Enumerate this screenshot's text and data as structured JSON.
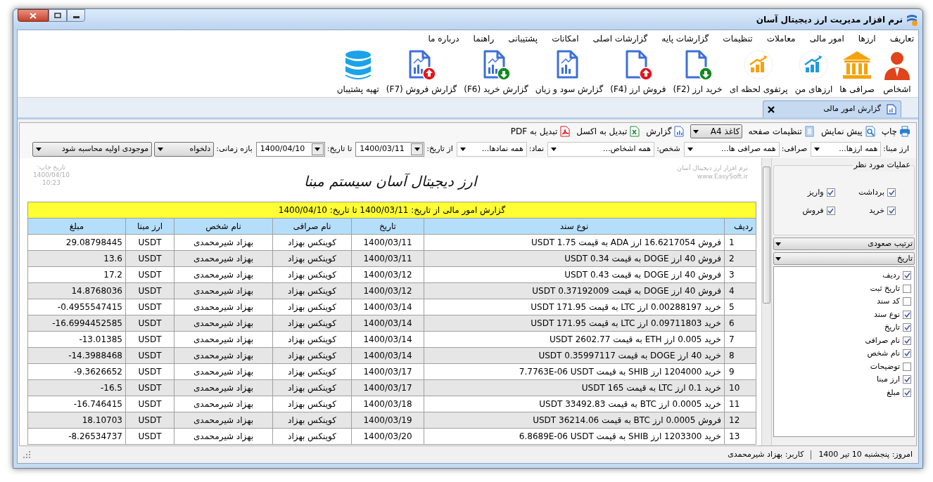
{
  "window": {
    "title": "نرم افزار مدیریت ارز دیجیتال آسان"
  },
  "menu": [
    "تعاریف",
    "ارزها",
    "امور مالی",
    "معاملات",
    "تنظیمات",
    "گزارشات پایه",
    "گزارشات اصلی",
    "امکانات",
    "پشتیبانی",
    "راهنما",
    "درباره ما"
  ],
  "toolbar": [
    {
      "label": "اشخاص"
    },
    {
      "label": "صرافی ها"
    },
    {
      "label": "ارزهای من"
    },
    {
      "label": "پرتفوی لحظه ای"
    },
    {
      "label": "خرید ارز (F2)"
    },
    {
      "label": "فروش ارز (F4)"
    },
    {
      "label": "گزارش سود و زیان"
    },
    {
      "label": "گزارش خرید (F6)"
    },
    {
      "label": "گزارش فروش (F7)"
    },
    {
      "label": "تهیه پشتیبان"
    }
  ],
  "tabs": [
    {
      "label": "گزارش امور مالی",
      "selected": true
    }
  ],
  "print_toolbar": [
    {
      "kind": "button",
      "label": "چاپ"
    },
    {
      "kind": "button",
      "label": "پیش نمایش"
    },
    {
      "kind": "button",
      "label": "تنظیمات صفحه"
    },
    {
      "kind": "dropdown",
      "value": "کاغذ A4"
    },
    {
      "kind": "button",
      "label": "گزارش"
    },
    {
      "kind": "button",
      "label": "تبدیل به اکسل"
    },
    {
      "kind": "button",
      "label": "تبدیل به PDF"
    }
  ],
  "filters": [
    {
      "kind": "combo",
      "label": "ارز مبنا:",
      "value": "همه ارزها..."
    },
    {
      "kind": "combo",
      "label": "صرافی:",
      "value": "همه صرافی ها..."
    },
    {
      "kind": "combo",
      "label": "شخص:",
      "value": "همه اشخاص..."
    },
    {
      "kind": "combo",
      "label": "نماد:",
      "value": "همه نمادها..."
    },
    {
      "kind": "date",
      "label": "از تاریخ:",
      "value": "1400/03/11"
    },
    {
      "kind": "date",
      "label": "تا تاریخ:",
      "value": "1400/04/10"
    },
    {
      "kind": "select",
      "label": "بازه زمانی:",
      "value": "دلخواه"
    },
    {
      "kind": "select",
      "value": "موجودی اولیه محاسبه شود"
    }
  ],
  "report": {
    "brand_lines": [
      "نرم افزار ارز دیجیتال آسان",
      "www.EasySoft.ir"
    ],
    "title": "ارز دیجیتال آسان سیستم مبنا",
    "print_info": [
      "تاریخ چاپ:",
      "1400/04/10",
      "10:23"
    ],
    "caption": "گزارش امور مالی از تاریخ: 1400/03/11 تا تاریخ: 1400/04/10",
    "table": {
      "columns": [
        "ردیف",
        "نوع سند",
        "تاریخ",
        "نام صرافی",
        "نام شخص",
        "ارز مبنا",
        "مبلغ"
      ],
      "rows": [
        [
          "1",
          "فروش 16.6217054 ارز ADA به قیمت 1.75 USDT",
          "1400/03/11",
          "کوینکس بهزاد",
          "بهزاد شیرمحمدی",
          "USDT",
          "29.08798445"
        ],
        [
          "2",
          "فروش 40 ارز DOGE به قیمت 0.34 USDT",
          "1400/03/11",
          "کوینکس بهزاد",
          "بهزاد شیرمحمدی",
          "USDT",
          "13.6"
        ],
        [
          "3",
          "فروش 40 ارز DOGE به قیمت 0.43 USDT",
          "1400/03/12",
          "کوینکس بهزاد",
          "بهزاد شیرمحمدی",
          "USDT",
          "17.2"
        ],
        [
          "4",
          "فروش 40 ارز DOGE به قیمت 0.37192009 USDT",
          "1400/03/12",
          "کوینکس بهزاد",
          "بهزاد شیرمحمدی",
          "USDT",
          "14.8768036"
        ],
        [
          "5",
          "خرید 0.00288197 ارز LTC به قیمت 171.95 USDT",
          "1400/03/14",
          "کوینکس بهزاد",
          "بهزاد شیرمحمدی",
          "USDT",
          "-0.4955547415"
        ],
        [
          "6",
          "خرید 0.09711803 ارز LTC به قیمت 171.95 USDT",
          "1400/03/14",
          "کوینکس بهزاد",
          "بهزاد شیرمحمدی",
          "USDT",
          "-16.6994452585"
        ],
        [
          "7",
          "خرید 0.005 ارز ETH به قیمت 2602.77 USDT",
          "1400/03/14",
          "کوینکس بهزاد",
          "بهزاد شیرمحمدی",
          "USDT",
          "-13.01385"
        ],
        [
          "8",
          "خرید 40 ارز DOGE به قیمت 0.35997117 USDT",
          "1400/03/14",
          "کوینکس بهزاد",
          "بهزاد شیرمحمدی",
          "USDT",
          "-14.3988468"
        ],
        [
          "9",
          "خرید 1204000 ارز SHIB به قیمت 7.7763E-06 USDT",
          "1400/03/17",
          "کوینکس بهزاد",
          "بهزاد شیرمحمدی",
          "USDT",
          "-9.3626652"
        ],
        [
          "10",
          "خرید 0.1 ارز LTC به قیمت 165 USDT",
          "1400/03/17",
          "کوینکس بهزاد",
          "بهزاد شیرمحمدی",
          "USDT",
          "-16.5"
        ],
        [
          "11",
          "خرید 0.0005 ارز BTC به قیمت 33492.83 USDT",
          "1400/03/18",
          "کوینکس بهزاد",
          "بهزاد شیرمحمدی",
          "USDT",
          "-16.746415"
        ],
        [
          "12",
          "فروش 0.0005 ارز BTC به قیمت 36214.06 USDT",
          "1400/03/19",
          "کوینکس بهزاد",
          "بهزاد شیرمحمدی",
          "USDT",
          "18.10703"
        ],
        [
          "13",
          "خرید 1203300 ارز SHIB به قیمت 6.8689E-06 USDT",
          "1400/03/20",
          "کوینکس بهزاد",
          "بهزاد شیرمحمدی",
          "USDT",
          "-8.26534737"
        ]
      ]
    }
  },
  "side_panel": {
    "group_title": "عملیات مورد نظر",
    "operations": [
      {
        "label": "برداشت",
        "checked": true
      },
      {
        "label": "واریز",
        "checked": true
      },
      {
        "label": "خرید",
        "checked": true
      },
      {
        "label": "فروش",
        "checked": true
      }
    ],
    "sort_order": "ترتیب صعودی",
    "sort_by": "تاریخ",
    "columns": [
      {
        "label": "ردیف",
        "checked": true
      },
      {
        "label": "تاریخ ثبت",
        "checked": false
      },
      {
        "label": "کد سند",
        "checked": false
      },
      {
        "label": "نوع سند",
        "checked": true
      },
      {
        "label": "تاریخ",
        "checked": true
      },
      {
        "label": "نام صرافی",
        "checked": true
      },
      {
        "label": "نام شخص",
        "checked": true
      },
      {
        "label": "توضیحات",
        "checked": false
      },
      {
        "label": "ارز مبنا",
        "checked": true
      },
      {
        "label": "مبلغ",
        "checked": true
      }
    ]
  },
  "status_bar": {
    "today": "امروز: پنجشنبه 10 تیر 1400",
    "user": "کاربر: بهزاد شیرمحمدی"
  }
}
